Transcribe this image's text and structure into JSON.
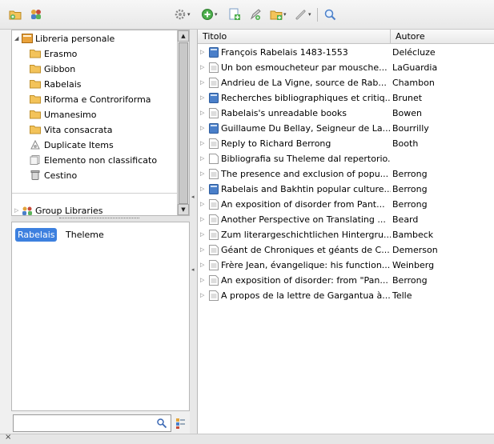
{
  "toolbar": {
    "left_icons": [
      "new-collection-icon",
      "new-group-icon"
    ],
    "right_icons": [
      "actions-gear-icon",
      "new-item-icon",
      "add-by-identifier-icon",
      "new-note-icon",
      "add-attachment-icon",
      "search-icon"
    ]
  },
  "collections": {
    "library_label": "Libreria personale",
    "folders": [
      {
        "label": "Erasmo",
        "icon": "folder-icon"
      },
      {
        "label": "Gibbon",
        "icon": "folder-icon"
      },
      {
        "label": "Rabelais",
        "icon": "folder-icon"
      },
      {
        "label": "Riforma e Controriforma",
        "icon": "folder-icon"
      },
      {
        "label": "Umanesimo",
        "icon": "folder-icon"
      },
      {
        "label": "Vita consacrata",
        "icon": "folder-icon"
      }
    ],
    "special": [
      {
        "label": "Duplicate Items",
        "icon": "duplicate-items-icon"
      },
      {
        "label": "Elemento non classificato",
        "icon": "unfiled-items-icon"
      },
      {
        "label": "Cestino",
        "icon": "trash-icon"
      }
    ],
    "group_label": "Group Libraries"
  },
  "tags": [
    {
      "label": "Rabelais",
      "selected": true
    },
    {
      "label": "Theleme",
      "selected": false
    }
  ],
  "items": {
    "columns": {
      "title": "Titolo",
      "author": "Autore"
    },
    "rows": [
      {
        "title": "François Rabelais 1483-1553",
        "author": "Delécluze",
        "type": "book"
      },
      {
        "title": "Un bon esmoucheteur par mousche...",
        "author": "LaGuardia",
        "type": "article"
      },
      {
        "title": "Andrieu de La Vigne, source de Rab...",
        "author": "Chambon",
        "type": "article"
      },
      {
        "title": "Recherches bibliographiques et critiq...",
        "author": "Brunet",
        "type": "book"
      },
      {
        "title": "Rabelais's unreadable books",
        "author": "Bowen",
        "type": "article"
      },
      {
        "title": "Guillaume Du Bellay, Seigneur de La...",
        "author": "Bourrilly",
        "type": "book"
      },
      {
        "title": "Reply to Richard Berrong",
        "author": "Booth",
        "type": "article"
      },
      {
        "title": "Bibliografia su Theleme dal repertorio...",
        "author": "",
        "type": "document"
      },
      {
        "title": "The presence and exclusion of popu...",
        "author": "Berrong",
        "type": "article"
      },
      {
        "title": "Rabelais and Bakhtin popular culture...",
        "author": "Berrong",
        "type": "book"
      },
      {
        "title": "An exposition of disorder from Pant...",
        "author": "Berrong",
        "type": "article"
      },
      {
        "title": "Another Perspective on Translating ...",
        "author": "Beard",
        "type": "article"
      },
      {
        "title": "Zum literargeschichtlichen Hintergru...",
        "author": "Bambeck",
        "type": "article"
      },
      {
        "title": "Géant de Chroniques et géants de C...",
        "author": "Demerson",
        "type": "article"
      },
      {
        "title": "Frère Jean, évangelique: his function...",
        "author": "Weinberg",
        "type": "article"
      },
      {
        "title": "An exposition of disorder: from \"Pan...",
        "author": "Berrong",
        "type": "article"
      },
      {
        "title": "A propos de la lettre de Gargantua à...",
        "author": "Telle",
        "type": "article"
      }
    ]
  },
  "colors": {
    "selection": "#3d80df",
    "folder": "#f3c35a",
    "book": "#4a7fc9"
  }
}
